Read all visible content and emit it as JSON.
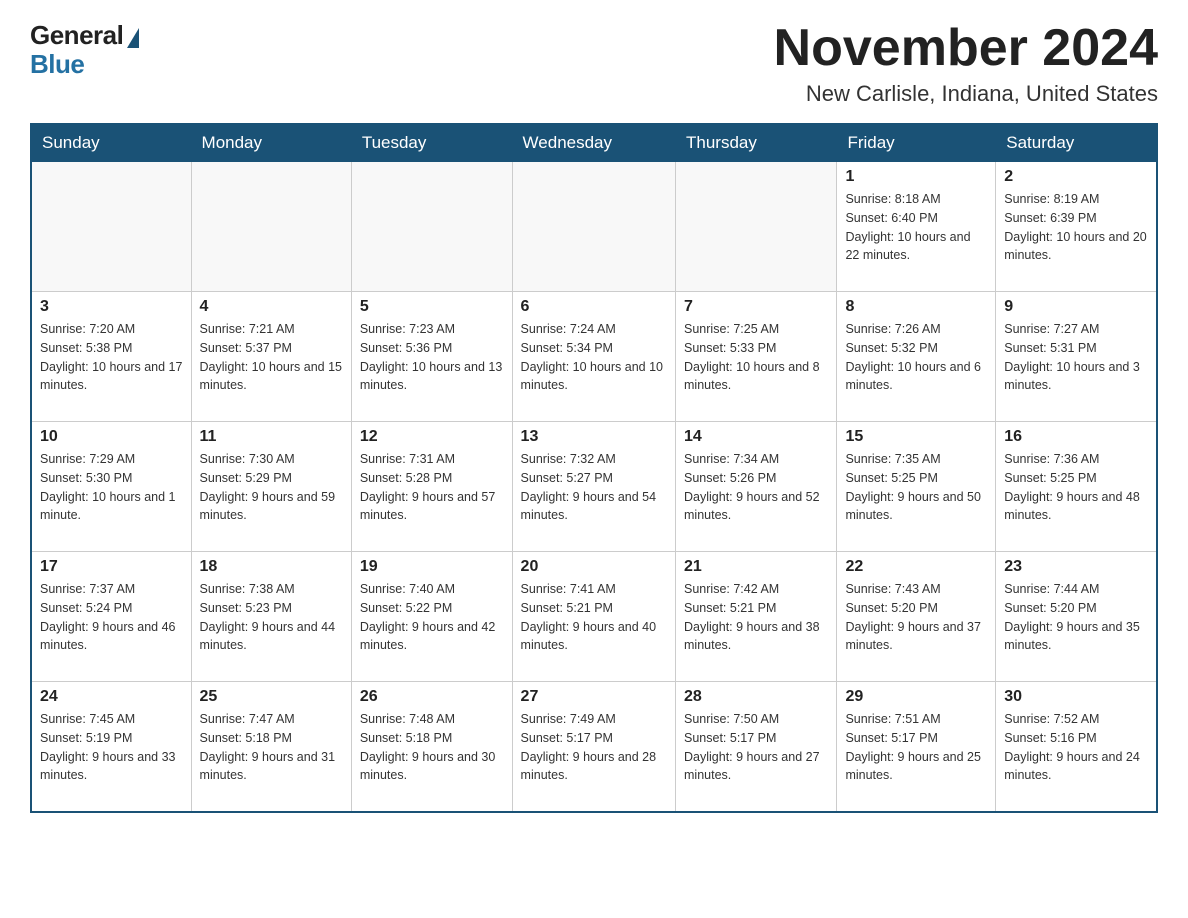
{
  "logo": {
    "general": "General",
    "blue": "Blue"
  },
  "title": "November 2024",
  "subtitle": "New Carlisle, Indiana, United States",
  "days": [
    "Sunday",
    "Monday",
    "Tuesday",
    "Wednesday",
    "Thursday",
    "Friday",
    "Saturday"
  ],
  "weeks": [
    [
      {
        "num": "",
        "sunrise": "",
        "sunset": "",
        "daylight": ""
      },
      {
        "num": "",
        "sunrise": "",
        "sunset": "",
        "daylight": ""
      },
      {
        "num": "",
        "sunrise": "",
        "sunset": "",
        "daylight": ""
      },
      {
        "num": "",
        "sunrise": "",
        "sunset": "",
        "daylight": ""
      },
      {
        "num": "",
        "sunrise": "",
        "sunset": "",
        "daylight": ""
      },
      {
        "num": "1",
        "sunrise": "Sunrise: 8:18 AM",
        "sunset": "Sunset: 6:40 PM",
        "daylight": "Daylight: 10 hours and 22 minutes."
      },
      {
        "num": "2",
        "sunrise": "Sunrise: 8:19 AM",
        "sunset": "Sunset: 6:39 PM",
        "daylight": "Daylight: 10 hours and 20 minutes."
      }
    ],
    [
      {
        "num": "3",
        "sunrise": "Sunrise: 7:20 AM",
        "sunset": "Sunset: 5:38 PM",
        "daylight": "Daylight: 10 hours and 17 minutes."
      },
      {
        "num": "4",
        "sunrise": "Sunrise: 7:21 AM",
        "sunset": "Sunset: 5:37 PM",
        "daylight": "Daylight: 10 hours and 15 minutes."
      },
      {
        "num": "5",
        "sunrise": "Sunrise: 7:23 AM",
        "sunset": "Sunset: 5:36 PM",
        "daylight": "Daylight: 10 hours and 13 minutes."
      },
      {
        "num": "6",
        "sunrise": "Sunrise: 7:24 AM",
        "sunset": "Sunset: 5:34 PM",
        "daylight": "Daylight: 10 hours and 10 minutes."
      },
      {
        "num": "7",
        "sunrise": "Sunrise: 7:25 AM",
        "sunset": "Sunset: 5:33 PM",
        "daylight": "Daylight: 10 hours and 8 minutes."
      },
      {
        "num": "8",
        "sunrise": "Sunrise: 7:26 AM",
        "sunset": "Sunset: 5:32 PM",
        "daylight": "Daylight: 10 hours and 6 minutes."
      },
      {
        "num": "9",
        "sunrise": "Sunrise: 7:27 AM",
        "sunset": "Sunset: 5:31 PM",
        "daylight": "Daylight: 10 hours and 3 minutes."
      }
    ],
    [
      {
        "num": "10",
        "sunrise": "Sunrise: 7:29 AM",
        "sunset": "Sunset: 5:30 PM",
        "daylight": "Daylight: 10 hours and 1 minute."
      },
      {
        "num": "11",
        "sunrise": "Sunrise: 7:30 AM",
        "sunset": "Sunset: 5:29 PM",
        "daylight": "Daylight: 9 hours and 59 minutes."
      },
      {
        "num": "12",
        "sunrise": "Sunrise: 7:31 AM",
        "sunset": "Sunset: 5:28 PM",
        "daylight": "Daylight: 9 hours and 57 minutes."
      },
      {
        "num": "13",
        "sunrise": "Sunrise: 7:32 AM",
        "sunset": "Sunset: 5:27 PM",
        "daylight": "Daylight: 9 hours and 54 minutes."
      },
      {
        "num": "14",
        "sunrise": "Sunrise: 7:34 AM",
        "sunset": "Sunset: 5:26 PM",
        "daylight": "Daylight: 9 hours and 52 minutes."
      },
      {
        "num": "15",
        "sunrise": "Sunrise: 7:35 AM",
        "sunset": "Sunset: 5:25 PM",
        "daylight": "Daylight: 9 hours and 50 minutes."
      },
      {
        "num": "16",
        "sunrise": "Sunrise: 7:36 AM",
        "sunset": "Sunset: 5:25 PM",
        "daylight": "Daylight: 9 hours and 48 minutes."
      }
    ],
    [
      {
        "num": "17",
        "sunrise": "Sunrise: 7:37 AM",
        "sunset": "Sunset: 5:24 PM",
        "daylight": "Daylight: 9 hours and 46 minutes."
      },
      {
        "num": "18",
        "sunrise": "Sunrise: 7:38 AM",
        "sunset": "Sunset: 5:23 PM",
        "daylight": "Daylight: 9 hours and 44 minutes."
      },
      {
        "num": "19",
        "sunrise": "Sunrise: 7:40 AM",
        "sunset": "Sunset: 5:22 PM",
        "daylight": "Daylight: 9 hours and 42 minutes."
      },
      {
        "num": "20",
        "sunrise": "Sunrise: 7:41 AM",
        "sunset": "Sunset: 5:21 PM",
        "daylight": "Daylight: 9 hours and 40 minutes."
      },
      {
        "num": "21",
        "sunrise": "Sunrise: 7:42 AM",
        "sunset": "Sunset: 5:21 PM",
        "daylight": "Daylight: 9 hours and 38 minutes."
      },
      {
        "num": "22",
        "sunrise": "Sunrise: 7:43 AM",
        "sunset": "Sunset: 5:20 PM",
        "daylight": "Daylight: 9 hours and 37 minutes."
      },
      {
        "num": "23",
        "sunrise": "Sunrise: 7:44 AM",
        "sunset": "Sunset: 5:20 PM",
        "daylight": "Daylight: 9 hours and 35 minutes."
      }
    ],
    [
      {
        "num": "24",
        "sunrise": "Sunrise: 7:45 AM",
        "sunset": "Sunset: 5:19 PM",
        "daylight": "Daylight: 9 hours and 33 minutes."
      },
      {
        "num": "25",
        "sunrise": "Sunrise: 7:47 AM",
        "sunset": "Sunset: 5:18 PM",
        "daylight": "Daylight: 9 hours and 31 minutes."
      },
      {
        "num": "26",
        "sunrise": "Sunrise: 7:48 AM",
        "sunset": "Sunset: 5:18 PM",
        "daylight": "Daylight: 9 hours and 30 minutes."
      },
      {
        "num": "27",
        "sunrise": "Sunrise: 7:49 AM",
        "sunset": "Sunset: 5:17 PM",
        "daylight": "Daylight: 9 hours and 28 minutes."
      },
      {
        "num": "28",
        "sunrise": "Sunrise: 7:50 AM",
        "sunset": "Sunset: 5:17 PM",
        "daylight": "Daylight: 9 hours and 27 minutes."
      },
      {
        "num": "29",
        "sunrise": "Sunrise: 7:51 AM",
        "sunset": "Sunset: 5:17 PM",
        "daylight": "Daylight: 9 hours and 25 minutes."
      },
      {
        "num": "30",
        "sunrise": "Sunrise: 7:52 AM",
        "sunset": "Sunset: 5:16 PM",
        "daylight": "Daylight: 9 hours and 24 minutes."
      }
    ]
  ]
}
